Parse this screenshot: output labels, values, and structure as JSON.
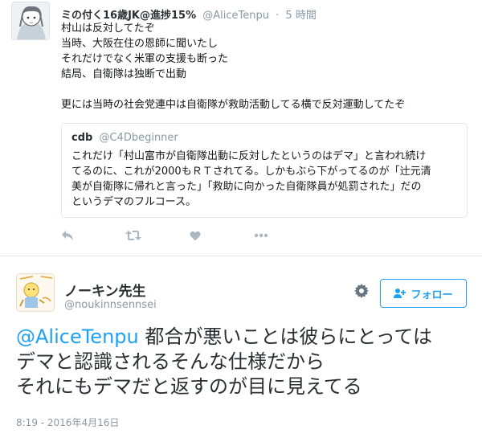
{
  "tweet1": {
    "author_name": "ミの付く16歳JK@進捗15%",
    "author_handle": "@AliceTenpu",
    "separator": "·",
    "time": "5 時間",
    "lines": [
      "村山は反対してたぞ",
      "当時、大阪在住の恩師に聞いたし",
      "それだけでなく米軍の支援も断った",
      "結局、自衛隊は独断で出動"
    ],
    "line_extra": "更には当時の社会党連中は自衛隊が救助活動してる横で反対運動してたぞ",
    "quote": {
      "name": "cdb",
      "handle": "@C4Dbeginner",
      "lines": [
        "これだけ「村山富市が自衛隊出動に反対したというのはデマ」と言われ続け",
        "てるのに、これが2000もＲＴされてる。しかもぶら下がってるのが「辻元清",
        "美が自衛隊に帰れと言った」「救助に向かった自衛隊員が処罰された」だの",
        "というデマのフルコース。"
      ]
    },
    "actions": [
      "reply-icon",
      "retweet-icon",
      "like-icon",
      "more-icon"
    ]
  },
  "tweet2": {
    "author_name": "ノーキン先生",
    "author_handle": "@noukinnsennsei",
    "follow_label": "フォロー",
    "mention": "@AliceTenpu",
    "text_first": " 都合が悪いことは彼らにとっては",
    "text_lines": [
      "デマと認識されるそんな仕様だから",
      "それにもデマだと返すのが目に見えてる"
    ],
    "timestamp": "8:19 - 2016年4月16日"
  },
  "colors": {
    "accent": "#1da1f2",
    "muted": "#8899a6",
    "icon": "#aab8c2",
    "border": "#e1e8ed"
  }
}
